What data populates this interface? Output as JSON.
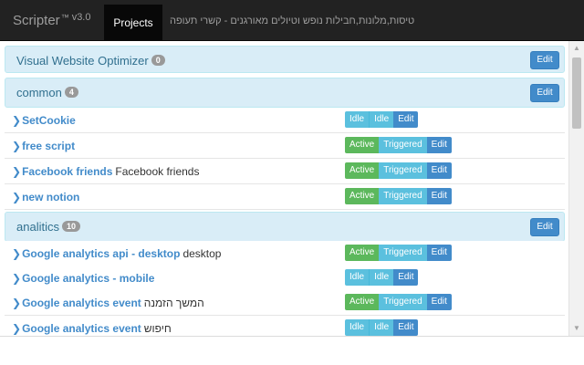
{
  "app": {
    "brand": "Scripter",
    "trademark": "™",
    "version": "v3.0",
    "nav_tab": "Projects",
    "tagline": "טיסות,מלונות,חבילות נופש וטיולים מאורגנים - קשרי תעופה"
  },
  "groups": [
    {
      "title": "Visual Website Optimizer",
      "count": "0",
      "edit_label": "Edit",
      "rows": []
    },
    {
      "title": "common",
      "count": "4",
      "edit_label": "Edit",
      "rows": [
        {
          "chevron": "❯",
          "name": "SetCookie",
          "desc": "",
          "status": "Idle",
          "state": "Idle",
          "edit": "Edit"
        },
        {
          "chevron": "❯",
          "name": "free script",
          "desc": "",
          "status": "Active",
          "state": "Triggered",
          "edit": "Edit"
        },
        {
          "chevron": "❯",
          "name": "Facebook friends",
          "desc": "Facebook friends",
          "status": "Active",
          "state": "Triggered",
          "edit": "Edit"
        },
        {
          "chevron": "❯",
          "name": "new notion",
          "desc": "",
          "status": "Active",
          "state": "Triggered",
          "edit": "Edit"
        }
      ]
    },
    {
      "title": "analitics",
      "count": "10",
      "edit_label": "Edit",
      "rows": [
        {
          "chevron": "❯",
          "name": "Google analytics api - desktop",
          "desc": "desktop",
          "status": "Active",
          "state": "Triggered",
          "edit": "Edit"
        },
        {
          "chevron": "❯",
          "name": "Google analytics - mobile",
          "desc": "",
          "status": "Idle",
          "state": "Idle",
          "edit": "Edit"
        },
        {
          "chevron": "❯",
          "name": "Google analytics event",
          "desc": "המשך הזמנה",
          "status": "Active",
          "state": "Triggered",
          "edit": "Edit"
        },
        {
          "chevron": "❯",
          "name": "Google analytics event",
          "desc": "חיפוש",
          "status": "Idle",
          "state": "Idle",
          "edit": "Edit"
        }
      ]
    }
  ],
  "icons": {
    "row_chevron": "chevron-right-icon",
    "scroll_up": "triangle-up-icon",
    "scroll_down": "triangle-down-icon"
  },
  "colors": {
    "navbar": "#222222",
    "panel_heading": "#d9edf7",
    "active": "#5cb85c",
    "info": "#5bc0de",
    "primary": "#428bca"
  }
}
